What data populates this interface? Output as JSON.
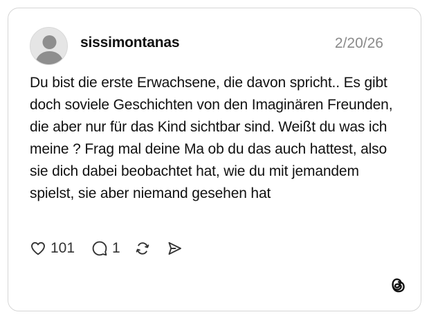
{
  "post": {
    "username": "sissimontanas",
    "date": "2/20/26",
    "text": "Du bist die erste Erwachsene, die davon spricht.. Es gibt doch soviele Geschichten von den Imaginären Freunden, die aber nur für das Kind sichtbar sind. Weißt du was ich meine ? Frag mal deine Ma ob du das auch hattest, also sie dich dabei beobachtet hat, wie du mit jemandem spielst, sie aber niemand gesehen hat",
    "likes": "101",
    "replies": "1"
  },
  "icons": {
    "avatar": "default-avatar-icon",
    "like": "heart-icon",
    "reply": "comment-icon",
    "repost": "repost-icon",
    "share": "send-icon",
    "brand": "threads-logo-icon"
  },
  "colors": {
    "background": "#ffffff",
    "border": "#d6d6d6",
    "text": "#111111",
    "muted": "#8a8a8a",
    "avatar_bg": "#e5e5e5",
    "avatar_fg": "#8e8e8e"
  }
}
